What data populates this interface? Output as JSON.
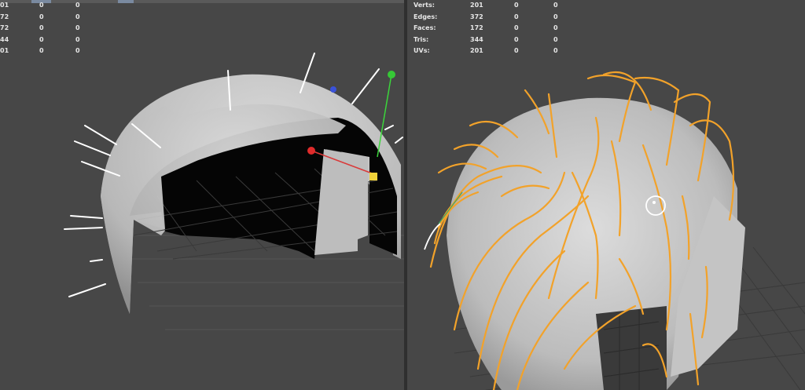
{
  "left_viewport": {
    "stats": [
      {
        "label": "",
        "v1": "01",
        "v2": "0",
        "v3": "0"
      },
      {
        "label": "",
        "v1": "72",
        "v2": "0",
        "v3": "0"
      },
      {
        "label": "",
        "v1": "72",
        "v2": "0",
        "v3": "0"
      },
      {
        "label": "",
        "v1": "44",
        "v2": "0",
        "v3": "0"
      },
      {
        "label": "",
        "v1": "01",
        "v2": "0",
        "v3": "0"
      }
    ]
  },
  "right_viewport": {
    "stats": [
      {
        "label": "Verts:",
        "v1": "201",
        "v2": "0",
        "v3": "0"
      },
      {
        "label": "Edges:",
        "v1": "372",
        "v2": "0",
        "v3": "0"
      },
      {
        "label": "Faces:",
        "v1": "172",
        "v2": "0",
        "v3": "0"
      },
      {
        "label": "Tris:",
        "v1": "344",
        "v2": "0",
        "v3": "0"
      },
      {
        "label": "UVs:",
        "v1": "201",
        "v2": "0",
        "v3": "0"
      }
    ]
  },
  "colors": {
    "viewport_bg": "#474747",
    "mesh": "#c8c8c8",
    "hair_curves": "#f2a22a",
    "grid": "#2a2a2a"
  },
  "icons": [
    "move-manipulator-icon",
    "cursor-circle-icon"
  ]
}
